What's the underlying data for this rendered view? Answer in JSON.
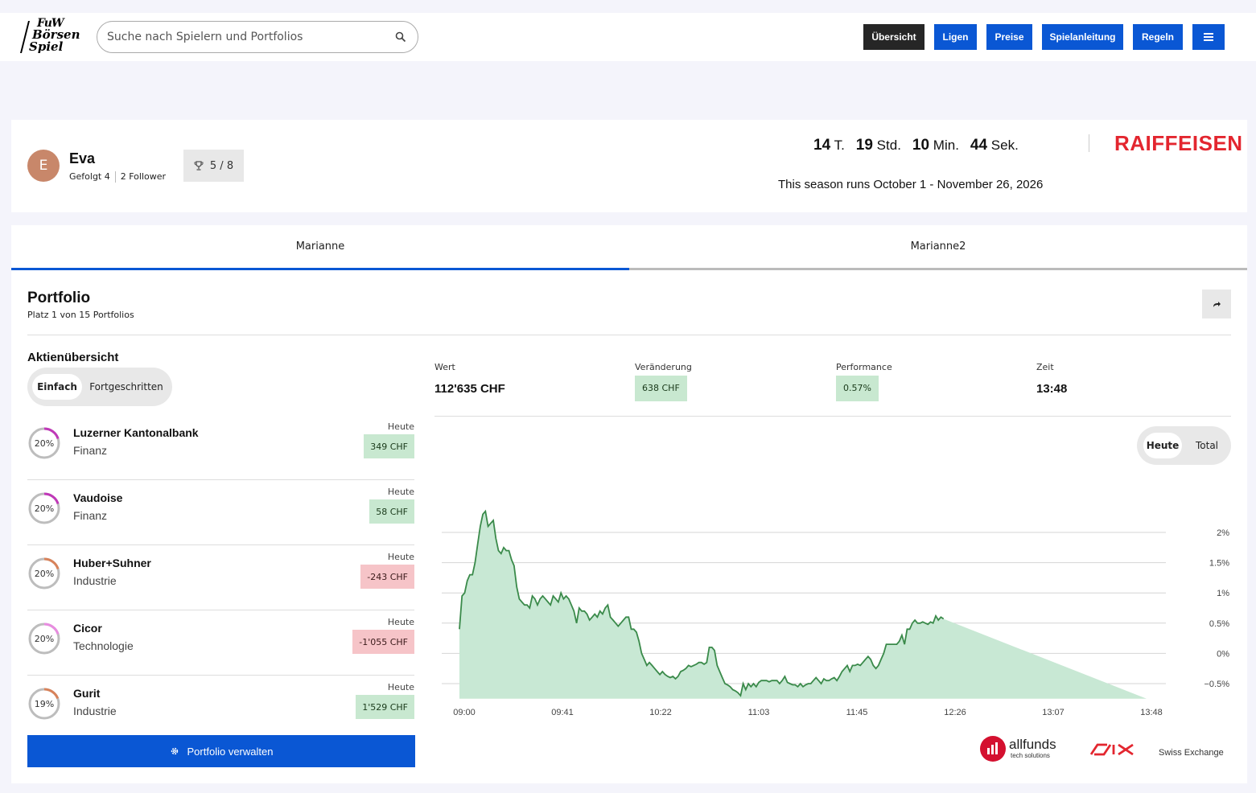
{
  "header": {
    "logo_lines": [
      "FuW",
      "Börsen",
      "Spiel"
    ],
    "search_placeholder": "Suche nach Spielern und Portfolios",
    "nav": [
      "Übersicht",
      "Ligen",
      "Preise",
      "Spielanleitung",
      "Regeln"
    ]
  },
  "profile": {
    "avatar_letter": "E",
    "name": "Eva",
    "following": "Gefolgt 4",
    "followers": "2 Follower",
    "trophies": "5 / 8",
    "countdown": [
      {
        "num": "14",
        "unit": "T."
      },
      {
        "num": "19",
        "unit": "Std."
      },
      {
        "num": "10",
        "unit": "Min."
      },
      {
        "num": "44",
        "unit": "Sek."
      }
    ],
    "season": "This season runs October 1 - November 26, 2026",
    "sponsor": "RAIFFEISEN"
  },
  "tabs": [
    "Marianne",
    "Marianne2"
  ],
  "portfolio": {
    "title": "Portfolio",
    "subtitle": "Platz 1 von 15 Portfolios",
    "overview_title": "Aktienübersicht",
    "view_options": [
      "Einfach",
      "Fortgeschritten"
    ],
    "stocks": [
      {
        "name": "Luzerner Kantonalbank",
        "sector": "Finanz",
        "weight": "20%",
        "weight_value": 0.2,
        "ring_color": "#c038b8",
        "label": "Heute",
        "change": "349 CHF",
        "positive": true
      },
      {
        "name": "Vaudoise",
        "sector": "Finanz",
        "weight": "20%",
        "weight_value": 0.2,
        "ring_color": "#c038b8",
        "label": "Heute",
        "change": "58 CHF",
        "positive": true
      },
      {
        "name": "Huber+Suhner",
        "sector": "Industrie",
        "weight": "20%",
        "weight_value": 0.2,
        "ring_color": "#d8825a",
        "label": "Heute",
        "change": "-243 CHF",
        "positive": false
      },
      {
        "name": "Cicor",
        "sector": "Technologie",
        "weight": "20%",
        "weight_value": 0.2,
        "ring_color": "#e88ce0",
        "label": "Heute",
        "change": "-1'055 CHF",
        "positive": false
      },
      {
        "name": "Gurit",
        "sector": "Industrie",
        "weight": "19%",
        "weight_value": 0.19,
        "ring_color": "#d8825a",
        "label": "Heute",
        "change": "1'529 CHF",
        "positive": true
      }
    ],
    "manage_label": "Portfolio verwalten"
  },
  "stats": {
    "wert_label": "Wert",
    "wert": "112'635 CHF",
    "change_label": "Veränderung",
    "change": "638 CHF",
    "perf_label": "Performance",
    "perf": "0.57%",
    "time_label": "Zeit",
    "time": "13:48"
  },
  "range_options": [
    "Heute",
    "Total"
  ],
  "chart_data": {
    "type": "area",
    "x_ticks": [
      "09:00",
      "09:41",
      "10:22",
      "11:03",
      "11:45",
      "12:26",
      "13:07",
      "13:48"
    ],
    "y_ticks": [
      2,
      1.5,
      1,
      0.5,
      0,
      -0.5
    ],
    "y_tick_labels": [
      "2%",
      "1.5%",
      "1%",
      "0.5%",
      "0%",
      "−0.5%"
    ],
    "ylim": [
      -0.75,
      2.4
    ],
    "grid": true,
    "line_color": "#3a8a4a",
    "fill_color": "#c8e8d4",
    "series": [
      {
        "x_minutes": [
          0,
          2,
          4,
          6,
          8,
          10,
          12,
          14,
          16,
          18,
          20,
          22,
          24,
          26,
          28,
          30,
          32,
          34,
          36,
          38,
          40,
          42,
          44,
          46,
          48,
          50,
          52,
          54,
          56,
          58,
          60,
          62,
          64,
          66,
          68,
          70,
          72,
          74,
          76,
          78,
          80,
          82,
          84,
          86,
          88,
          90,
          92,
          94,
          96,
          98,
          100,
          102,
          104,
          106,
          108,
          110,
          112,
          114,
          116,
          118,
          120,
          122,
          124,
          126,
          128,
          130,
          132,
          134,
          136,
          138,
          140,
          142,
          144,
          146,
          148,
          150,
          152,
          154,
          156,
          158,
          160,
          162,
          164,
          166,
          168,
          170,
          172,
          174,
          176,
          178,
          180,
          182,
          184,
          186,
          188,
          190,
          192,
          194,
          196,
          198,
          200,
          202,
          204,
          206,
          208,
          210,
          212,
          214,
          216,
          218,
          220,
          222,
          224,
          226,
          228,
          230,
          232,
          234,
          236,
          238,
          240,
          242,
          244,
          246,
          248,
          250,
          252,
          254,
          256,
          258,
          260,
          262,
          264,
          266,
          268,
          270,
          272,
          274,
          276,
          278,
          280,
          282,
          284,
          286,
          288,
          290,
          292,
          294,
          296,
          298,
          300,
          302,
          304,
          306,
          308,
          310,
          312,
          314,
          316,
          318,
          320,
          322,
          324,
          326,
          328,
          330,
          332,
          334,
          336,
          338,
          340,
          342,
          344,
          346,
          348,
          350,
          352,
          354,
          356,
          358,
          360,
          362,
          364,
          366,
          368,
          370,
          372,
          374,
          376,
          378,
          380,
          382,
          384,
          386,
          388,
          390,
          392,
          394,
          396,
          398,
          400,
          402,
          404,
          406,
          408,
          410,
          412,
          414,
          416,
          418,
          420,
          422,
          424,
          426,
          428,
          430,
          432,
          434,
          436,
          438,
          440,
          442,
          444,
          446,
          448,
          450,
          452,
          454,
          456,
          458,
          460,
          462,
          464,
          466,
          468,
          470,
          472,
          474,
          476,
          478,
          480,
          482,
          484,
          486,
          488,
          490,
          492,
          494,
          496,
          498,
          500,
          502,
          504,
          506,
          508,
          510,
          512,
          514,
          516,
          518,
          520,
          522,
          524,
          526,
          528
        ],
        "values": [
          0.4,
          0.95,
          1.0,
          1.2,
          1.3,
          1.3,
          1.5,
          1.8,
          2.1,
          2.3,
          2.35,
          2.1,
          2.15,
          2.2,
          1.9,
          1.7,
          1.65,
          1.75,
          1.7,
          1.7,
          1.55,
          1.45,
          1.1,
          0.9,
          0.85,
          0.8,
          0.8,
          0.75,
          0.95,
          0.9,
          0.8,
          0.9,
          0.95,
          0.9,
          0.85,
          0.8,
          0.95,
          0.9,
          0.85,
          1.0,
          0.9,
          0.95,
          0.9,
          0.8,
          0.7,
          0.5,
          0.75,
          0.7,
          0.7,
          0.65,
          0.55,
          0.6,
          0.65,
          0.6,
          0.7,
          0.65,
          0.75,
          0.8,
          0.6,
          0.55,
          0.5,
          0.45,
          0.5,
          0.55,
          0.6,
          0.6,
          0.4,
          0.4,
          0.35,
          0.2,
          0.0,
          -0.1,
          -0.2,
          -0.15,
          -0.2,
          -0.25,
          -0.3,
          -0.35,
          -0.3,
          -0.35,
          -0.38,
          -0.4,
          -0.38,
          -0.42,
          -0.38,
          -0.3,
          -0.28,
          -0.25,
          -0.2,
          -0.22,
          -0.2,
          -0.18,
          -0.15,
          -0.15,
          -0.18,
          -0.15,
          0.1,
          0.1,
          0.05,
          -0.2,
          -0.3,
          -0.4,
          -0.5,
          -0.52,
          -0.55,
          -0.6,
          -0.62,
          -0.65,
          -0.7,
          -0.5,
          -0.6,
          -0.5,
          -0.55,
          -0.5,
          -0.55,
          -0.48,
          -0.45,
          -0.45,
          -0.45,
          -0.47,
          -0.45,
          -0.45,
          -0.45,
          -0.5,
          -0.45,
          -0.38,
          -0.48,
          -0.5,
          -0.52,
          -0.52,
          -0.55,
          -0.5,
          -0.55,
          -0.52,
          -0.5,
          -0.5,
          -0.45,
          -0.4,
          -0.45,
          -0.5,
          -0.42,
          -0.45,
          -0.45,
          -0.42,
          -0.4,
          -0.45,
          -0.38,
          -0.3,
          -0.25,
          -0.2,
          -0.3,
          -0.2,
          -0.2,
          -0.18,
          -0.2,
          -0.15,
          -0.1,
          -0.05,
          -0.1,
          -0.2,
          -0.25,
          -0.2,
          -0.1,
          0.0,
          0.15,
          0.15,
          0.15,
          0.15,
          0.15,
          0.2,
          0.3,
          0.15,
          0.4,
          0.4,
          0.5,
          0.55,
          0.5,
          0.5,
          0.52,
          0.5,
          0.48,
          0.52,
          0.5,
          0.62,
          0.55,
          0.6,
          0.57
        ]
      }
    ]
  },
  "footer_logos": {
    "allfunds": "allfunds",
    "allfunds_sub": "tech solutions",
    "six": "SIX",
    "six_sub": "Swiss Exchange"
  }
}
